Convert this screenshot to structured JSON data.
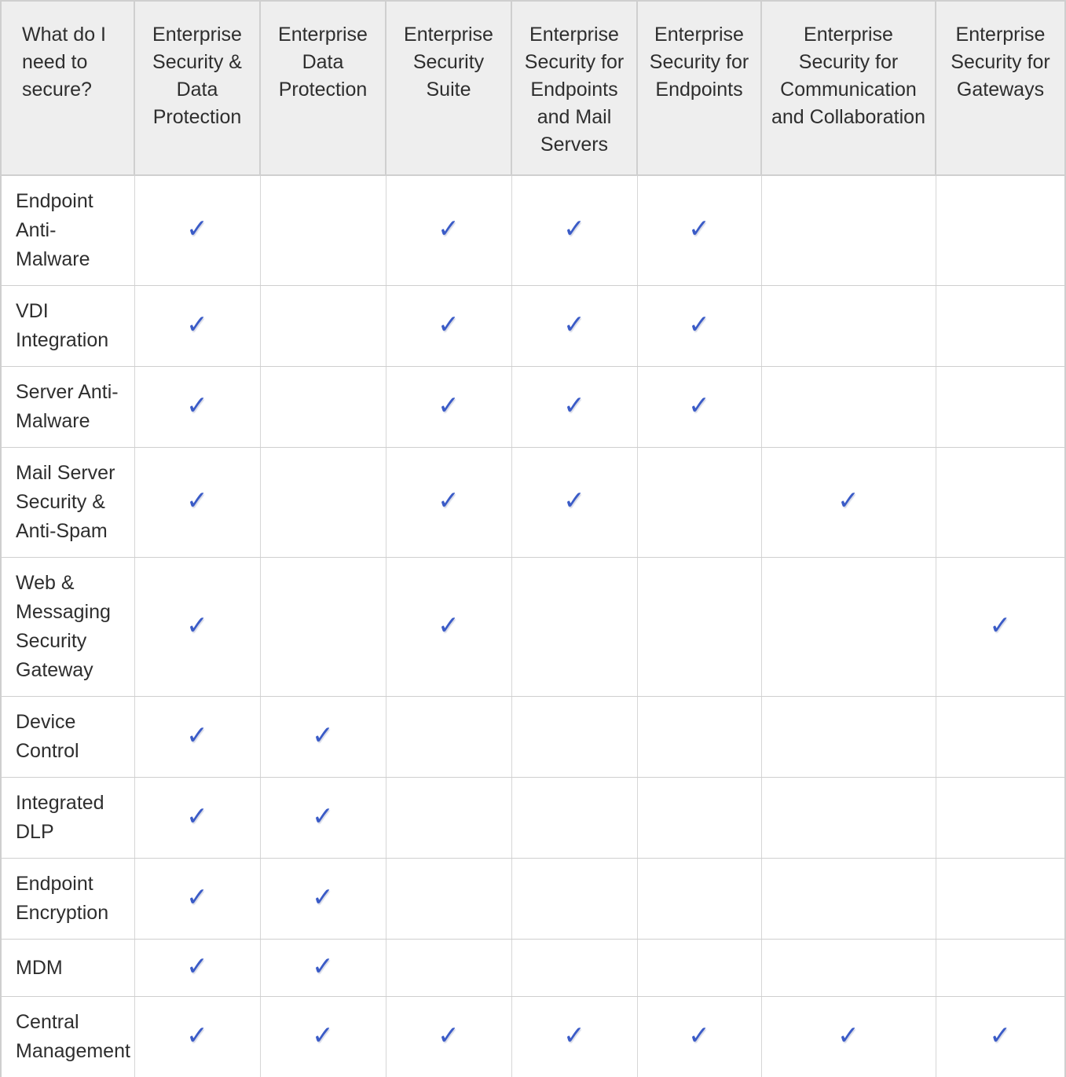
{
  "table": {
    "feature_column_header": "What do I need to secure?",
    "product_columns": [
      "Enterprise Security & Data Protection",
      "Enterprise Data Protection",
      "Enterprise Security Suite",
      "Enterprise Security for Endpoints and Mail Servers",
      "Enterprise Security for Endpoints",
      "Enterprise Security for Communication and Collaboration",
      "Enterprise Security for Gateways"
    ],
    "check_glyph": "✓",
    "check_color": "#3a5bc7",
    "header_background": "#eeeeee",
    "border_color": "#cfcfcf",
    "text_color": "#2e2e2e",
    "rows": [
      {
        "feature": "Endpoint Anti-Malware",
        "marks": [
          "✓",
          "",
          "✓",
          "✓",
          "✓",
          "",
          ""
        ]
      },
      {
        "feature": "VDI Integration",
        "marks": [
          "✓",
          "",
          "✓",
          "✓",
          "✓",
          "",
          ""
        ]
      },
      {
        "feature": "Server Anti-Malware",
        "marks": [
          "✓",
          "",
          "✓",
          "✓",
          "✓",
          "",
          ""
        ]
      },
      {
        "feature": "Mail Server Security & Anti-Spam",
        "marks": [
          "✓",
          "",
          "✓",
          "✓",
          "",
          "✓",
          ""
        ]
      },
      {
        "feature": "Web & Messaging Security Gateway",
        "marks": [
          "✓",
          "",
          "✓",
          "",
          "",
          "",
          "✓"
        ]
      },
      {
        "feature": "Device Control",
        "marks": [
          "✓",
          "✓",
          "",
          "",
          "",
          "",
          ""
        ]
      },
      {
        "feature": "Integrated DLP",
        "marks": [
          "✓",
          "✓",
          "",
          "",
          "",
          "",
          ""
        ]
      },
      {
        "feature": "Endpoint Encryption",
        "marks": [
          "✓",
          "✓",
          "",
          "",
          "",
          "",
          ""
        ]
      },
      {
        "feature": "MDM",
        "marks": [
          "✓",
          "✓",
          "",
          "",
          "",
          "",
          ""
        ]
      },
      {
        "feature": "Central Management",
        "marks": [
          "✓",
          "✓",
          "✓",
          "✓",
          "✓",
          "✓",
          "✓"
        ]
      }
    ]
  }
}
